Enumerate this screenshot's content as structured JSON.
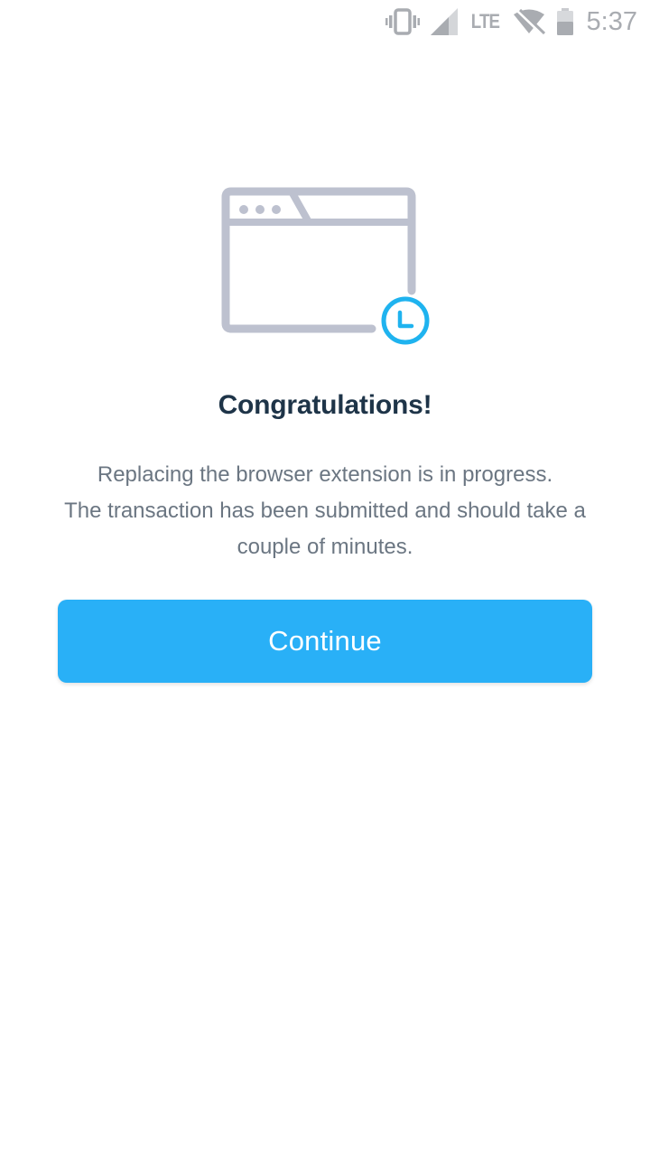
{
  "status_bar": {
    "network_type": "LTE",
    "time": "5:37",
    "icons": [
      "vibrate-icon",
      "signal-icon",
      "wifi-off-icon",
      "battery-icon"
    ]
  },
  "illustration": {
    "icons": [
      "browser-window-icon",
      "clock-icon"
    ],
    "colors": {
      "window_outline": "#bdc1cf",
      "clock": "#1fb3ef"
    }
  },
  "main": {
    "title": "Congratulations!",
    "message_lines": [
      "Replacing the browser extension is in progress.",
      "The transaction has been submitted and should take a",
      "couple of minutes."
    ],
    "continue_label": "Continue"
  },
  "colors": {
    "accent": "#29b0f7",
    "title": "#1e3448",
    "body_text": "#6b7682",
    "background": "#ffffff"
  }
}
